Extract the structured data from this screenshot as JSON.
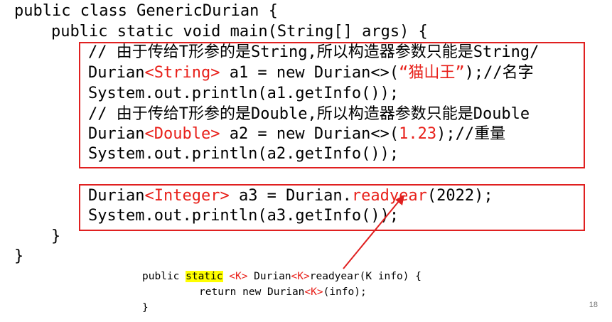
{
  "code": {
    "line1": "public class GenericDurian {",
    "line2": "public static void main(String[] args) {",
    "comment1": "// 由于传给T形参的是String,所以构造器参数只能是String/",
    "line4_a": "Durian",
    "line4_type": "<String>",
    "line4_b": " a1 = new Durian<>(",
    "line4_arg": "“猫山王”",
    "line4_c": ");//名字",
    "line5": "System.out.println(a1.getInfo());",
    "comment2": "// 由于传给T形参的是Double,所以构造器参数只能是Double",
    "line7_a": "Durian",
    "line7_type": "<Double>",
    "line7_b": " a2 = new Durian<>(",
    "line7_arg": "1.23",
    "line7_c": ");//重量",
    "line8": "System.out.println(a2.getInfo());",
    "line9_a": "Durian",
    "line9_type": "<Integer>",
    "line9_b": " a3 = Durian.",
    "line9_method": "readyear",
    "line9_c": "(2022);",
    "line10": "System.out.println(a3.getInfo());",
    "close_inner": "}",
    "close_outer": "}"
  },
  "snippet": {
    "l1_a": "public ",
    "l1_static": "static",
    "l1_b": " ",
    "l1_k1": "<K>",
    "l1_c": " Durian",
    "l1_k2": "<K>",
    "l1_d": "readyear(K info) {",
    "l2_a": "return new Durian",
    "l2_k": "<K>",
    "l2_b": "(info);",
    "l3": "}"
  },
  "page_number": "18",
  "colors": {
    "accent_red": "#e8201a",
    "box_red": "#e02020",
    "highlight": "#ffff00"
  }
}
